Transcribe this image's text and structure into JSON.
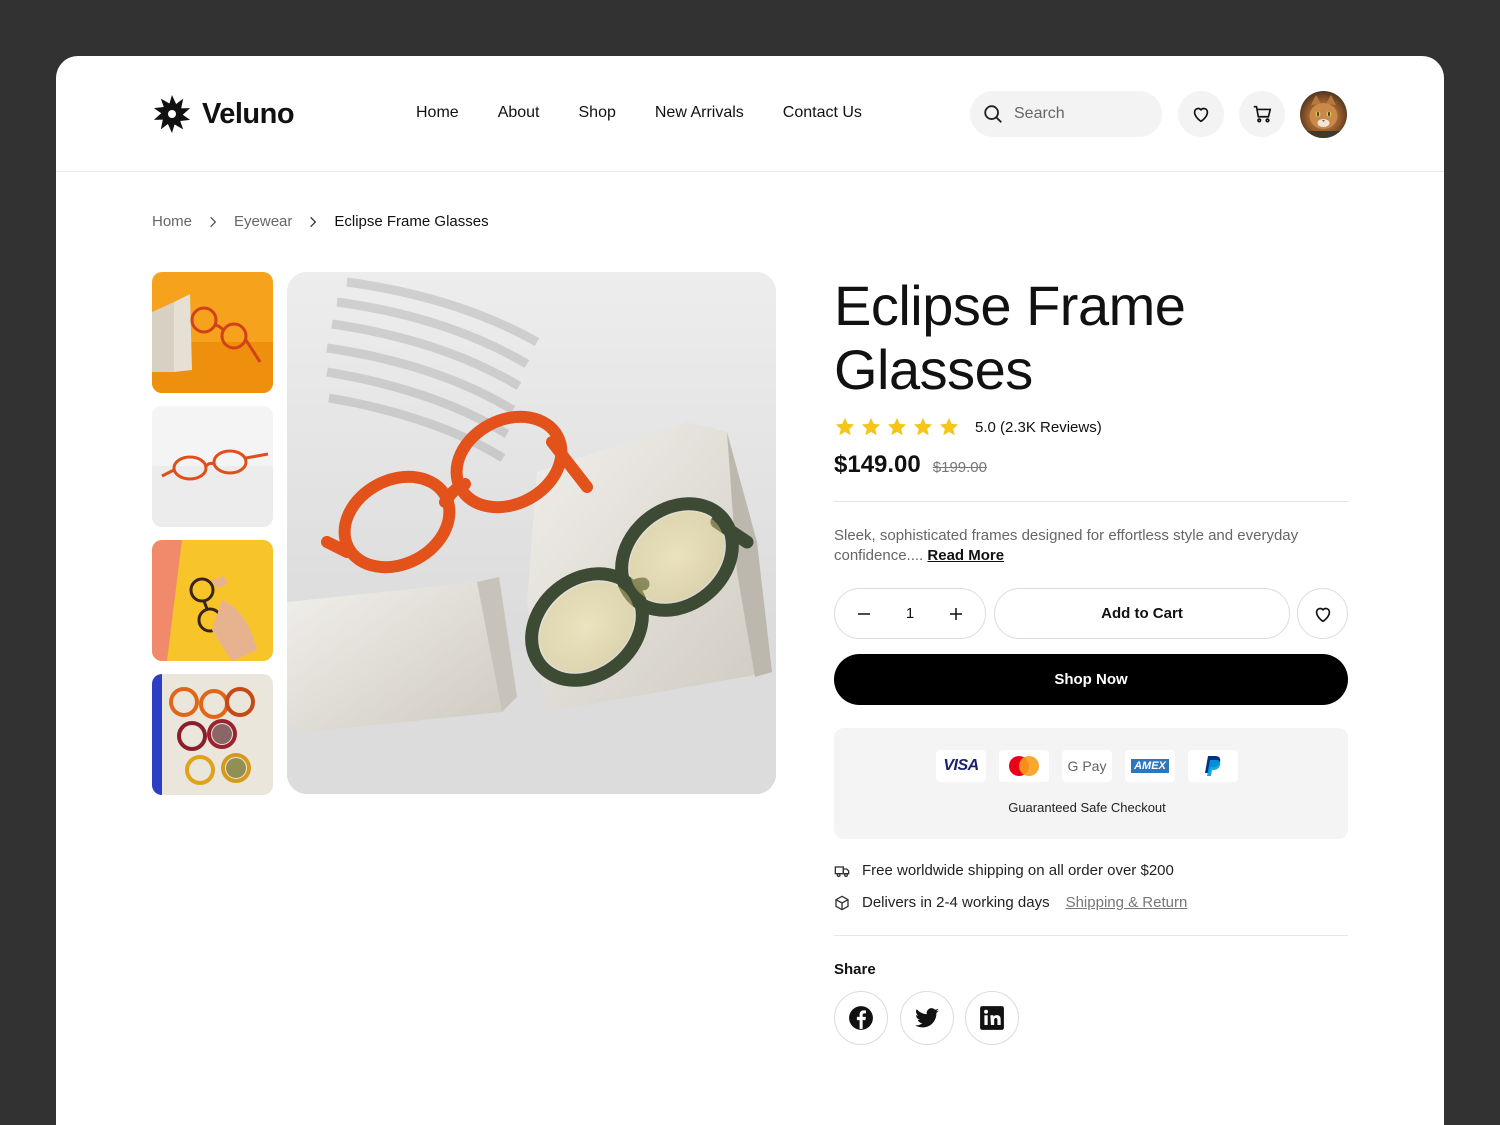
{
  "brand": {
    "name": "Veluno"
  },
  "nav": [
    "Home",
    "About",
    "Shop",
    "New Arrivals",
    "Contact Us"
  ],
  "search": {
    "placeholder": "Search"
  },
  "breadcrumb": [
    "Home",
    "Eyewear",
    "Eclipse Frame Glasses"
  ],
  "product": {
    "title": "Eclipse Frame Glasses",
    "rating_text": "5.0 (2.3K Reviews)",
    "rating_value": 5,
    "price": "$149.00",
    "old_price": "$199.00",
    "description": "Sleek, sophisticated frames designed for effortless style and everyday confidence....",
    "read_more": "Read More",
    "quantity": "1",
    "add_to_cart": "Add to Cart",
    "shop_now": "Shop Now"
  },
  "payment": {
    "methods": [
      "VISA",
      "Mastercard",
      "G Pay",
      "AMEX",
      "PayPal"
    ],
    "caption": "Guaranteed Safe Checkout"
  },
  "shipping": {
    "free_text": "Free worldwide shipping on all order over $200",
    "delivery_text": "Delivers in 2-4 working days",
    "link": "Shipping & Return"
  },
  "share": {
    "label": "Share",
    "networks": [
      "facebook",
      "twitter",
      "linkedin"
    ]
  },
  "colors": {
    "accent": "#000000",
    "star": "#f5c518",
    "frame_orange": "#e2521a",
    "frame_green": "#3d4a34"
  },
  "icons": [
    "search-icon",
    "heart-icon",
    "cart-icon",
    "chevron-right-icon",
    "star-icon",
    "minus-icon",
    "plus-icon",
    "truck-icon",
    "box-icon",
    "facebook-icon",
    "twitter-icon",
    "linkedin-icon"
  ]
}
